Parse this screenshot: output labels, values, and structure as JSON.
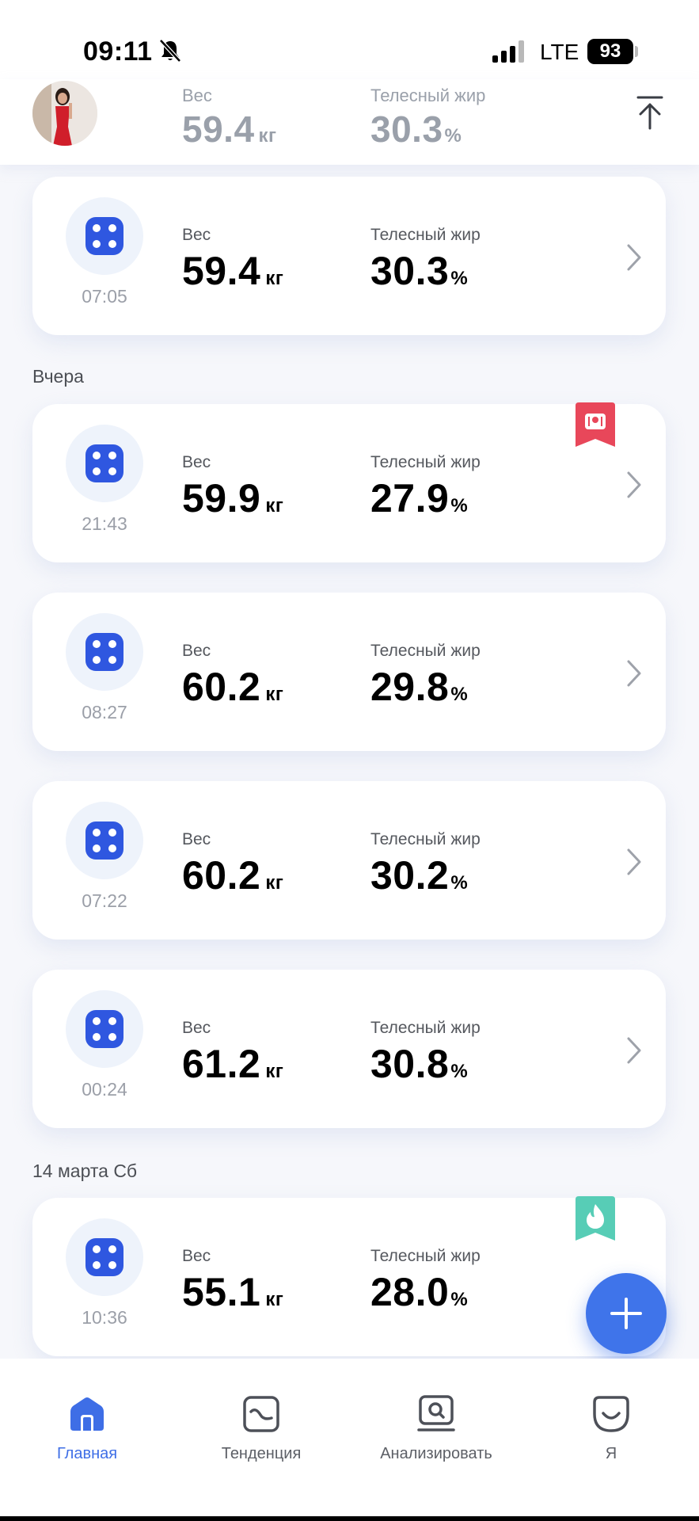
{
  "status": {
    "time": "09:11",
    "network": "LTE",
    "battery": "93"
  },
  "header": {
    "weight_label": "Вес",
    "weight_value": "59.4",
    "weight_unit": "кг",
    "fat_label": "Телесный жир",
    "fat_value": "30.3",
    "fat_unit": "%"
  },
  "labels": {
    "weight": "Вес",
    "fat": "Телесный жир",
    "kg": "кг",
    "pct": "%"
  },
  "sections": [
    {
      "title": ""
    },
    {
      "title": "Вчера"
    },
    {
      "title": "14 марта Сб"
    }
  ],
  "entries": [
    {
      "time": "07:05",
      "weight": "59.4",
      "fat": "30.3"
    },
    {
      "time": "21:43",
      "weight": "59.9",
      "fat": "27.9",
      "badge": "scale-badge-icon",
      "badge_color": "#e8475a"
    },
    {
      "time": "08:27",
      "weight": "60.2",
      "fat": "29.8"
    },
    {
      "time": "07:22",
      "weight": "60.2",
      "fat": "30.2"
    },
    {
      "time": "00:24",
      "weight": "61.2",
      "fat": "30.8"
    },
    {
      "time": "10:36",
      "weight": "55.1",
      "fat": "28.0",
      "badge": "flame-badge-icon",
      "badge_color": "#57cdb6"
    }
  ],
  "nav": [
    {
      "label": "Главная",
      "icon": "home-icon",
      "active": true
    },
    {
      "label": "Тенденция",
      "icon": "trend-icon",
      "active": false
    },
    {
      "label": "Анализировать",
      "icon": "analyze-icon",
      "active": false
    },
    {
      "label": "Я",
      "icon": "profile-icon",
      "active": false
    }
  ],
  "colors": {
    "accent": "#3f74ea",
    "scale_icon": "#2f57e0",
    "badge_red": "#e8475a",
    "badge_teal": "#57cdb6"
  }
}
